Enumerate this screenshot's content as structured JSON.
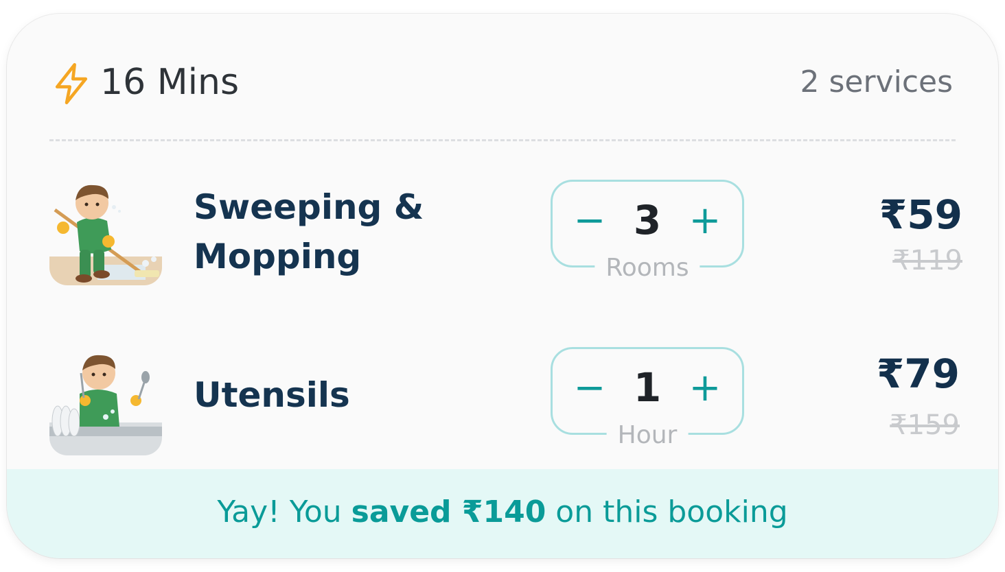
{
  "header": {
    "eta_text": "16 Mins",
    "service_count_text": "2 services",
    "bolt_icon": "lightning-bolt-icon"
  },
  "services": [
    {
      "name_line1": "Sweeping &",
      "name_line2": "Mopping",
      "quantity": "3",
      "unit": "Rooms",
      "price": "₹59",
      "original_price": "₹119",
      "image_icon": "cleaner-mopping-illustration"
    },
    {
      "name_line1": "Utensils",
      "quantity": "1",
      "unit": "Hour",
      "price": "₹79",
      "original_price": "₹159",
      "image_icon": "cleaner-utensils-illustration"
    }
  ],
  "stepper": {
    "minus_symbol": "−",
    "plus_symbol": "+"
  },
  "savings": {
    "prefix": "Yay! You ",
    "highlight": "saved ₹140",
    "suffix": " on this booking"
  },
  "colors": {
    "accent_teal": "#0e9a99",
    "stepper_border": "#a8dfe0",
    "savings_bg": "#e4f8f6",
    "bolt_orange": "#f5a623",
    "title_navy": "#153450"
  }
}
